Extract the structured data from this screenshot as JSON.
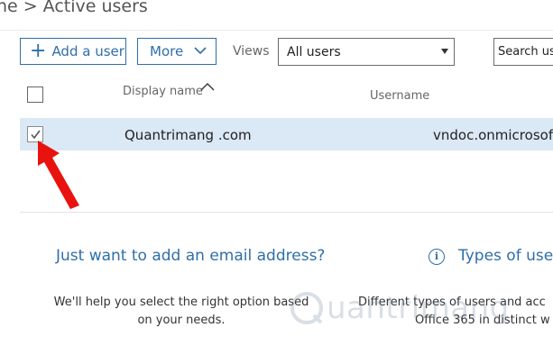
{
  "breadcrumb": {
    "parent": "ne",
    "separator": ">",
    "current": "Active users"
  },
  "toolbar": {
    "add_user_label": "Add a user",
    "more_label": "More",
    "views_label": "Views",
    "views_selected": "All users",
    "search_placeholder": "Search us"
  },
  "table": {
    "columns": [
      "Display name",
      "Username"
    ],
    "sort": {
      "column": "Display name",
      "direction": "ascending"
    },
    "rows": [
      {
        "display_name": "Quantrimang .com",
        "username": "vndoc.onmicrosoft.",
        "selected": true
      }
    ]
  },
  "promo": {
    "left_title": "Just want to add an email address?",
    "left_desc_line1": "We'll help you select the right option based",
    "left_desc_line2": "on your needs.",
    "right_title": "Types of user",
    "right_desc_line1": "Different types of users and acc",
    "right_desc_line2": "Office 365 in distinct w"
  },
  "watermark": {
    "text": "uantrimang"
  },
  "colors": {
    "accent": "#2f6fa8",
    "selected_row": "#dbe8f6",
    "annotation_arrow": "#e8130f"
  }
}
